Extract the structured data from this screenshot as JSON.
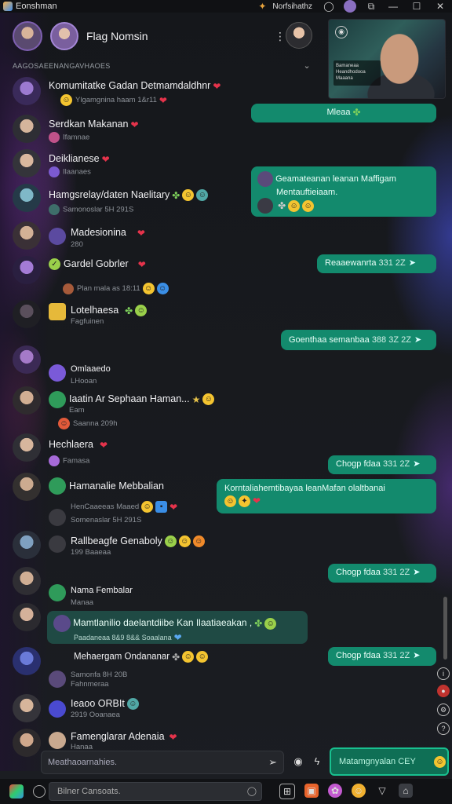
{
  "window": {
    "app_title": "Eonshman",
    "center_title": "Norfsihathz",
    "buttons": [
      "—",
      "☐",
      "✕"
    ]
  },
  "header": {
    "title": "Flag Nomsin"
  },
  "section_title": "AAGOSAEENANGAVHAOES",
  "items": [
    {
      "name": "Komumitatke Gadan Detmamdaldhnr",
      "sub": "Ylgamgnina haam 1&r11"
    },
    {
      "name": "Serdkan Makanan",
      "sub": "Ifamnae"
    },
    {
      "name": "Deiklianese",
      "sub": "Ilaanaes"
    },
    {
      "name": "Hamgsrelay/daten Naelitary",
      "sub": "Samonoslar 5H 291S"
    },
    {
      "name": "Madesionina",
      "sub": "280"
    },
    {
      "name": "Gardel Gobrler",
      "sub": "Plan mala as 18:11"
    },
    {
      "name": "Lotelhaesa",
      "sub": "Fagfuinen"
    },
    {
      "name": "Omlaaedo",
      "sub": "LHooan"
    },
    {
      "name": "Iaatin Ar Sephaan Haman...",
      "sub": "Eam",
      "sub2": "Saanna 209h"
    },
    {
      "name": "Hechlaera",
      "sub": "Famasa"
    },
    {
      "name": "Hamanalie Mebbalian",
      "sub": "Somenaslar 5H 291S",
      "sub_top": "HenCaaeeas Maaed"
    },
    {
      "name": "Rallbeagfe Genaboly",
      "sub": "199 Baaeaa"
    },
    {
      "name": "Nama Fembalar",
      "sub": "Manaa"
    },
    {
      "name": "Mehaergam Ondananar",
      "sub": "Samonfa 8H 20B",
      "sub2": "Fahnmeraa"
    },
    {
      "name": "Ieaoo ORBIt",
      "sub": "2919 Ooanaea"
    },
    {
      "name": "Famenglarar Adenaia",
      "sub": "Hanaa"
    }
  ],
  "bubbles": [
    {
      "text": "Mleaa"
    },
    {
      "text": "Geamateanan leanan Maffigam",
      "text2": "Mentauftieiaam."
    },
    {
      "text": "Reaaewanrta",
      "time": "331 2Z"
    },
    {
      "text": "Goenthaa semanbaa",
      "time": "388 3Z 2Z"
    },
    {
      "text": "Chogp fdaa",
      "time": "331 2Z"
    },
    {
      "text": "Korntaliahemtibayaa leanMafan olaltbanai"
    },
    {
      "text": "Chogp fdaa",
      "time": "331 2Z"
    },
    {
      "text": "Mamtlanilio daelantdiibe Kan Ilaatiaeakan ,",
      "text2": "Paadaneaa 8&9 8&& Soaalana"
    },
    {
      "text": "Chogp fdaa",
      "time": "331 2Z"
    }
  ],
  "video": {
    "caption": "Bamaneaa Heandhodooa Maaana"
  },
  "composer": {
    "placeholder": "Meathaoarnahies.",
    "send_label": "Matamgnyalan CEY"
  },
  "taskbar": {
    "search_placeholder": "Bilner Cansoats."
  },
  "colors": {
    "bubble": "#138a6d",
    "accent": "#18c08f",
    "background": "#1b1d22"
  }
}
